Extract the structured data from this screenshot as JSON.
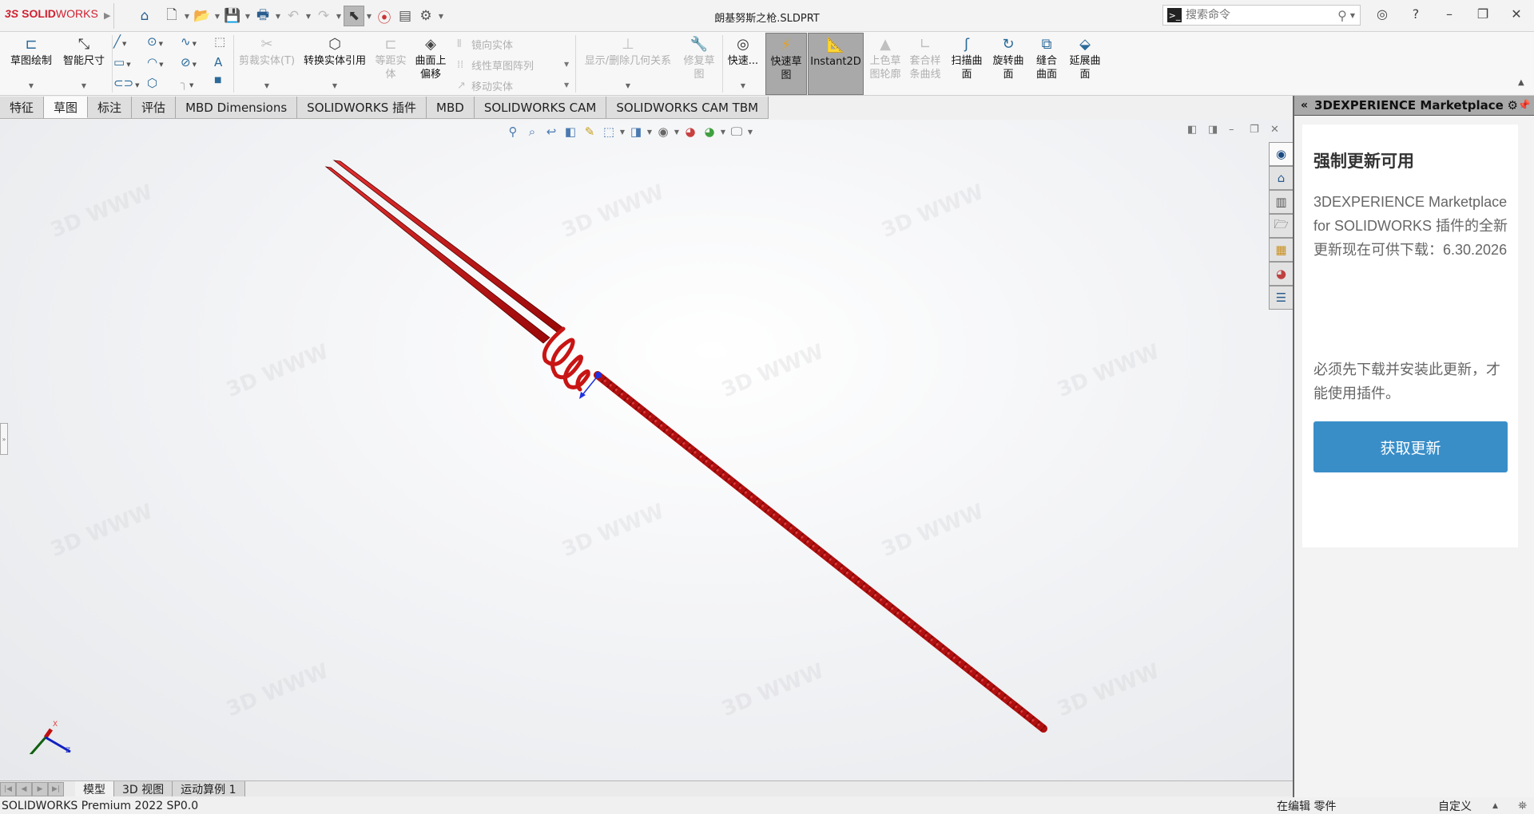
{
  "app": {
    "brand_prefix": "3S",
    "brand_bold": "SOLID",
    "brand_light": "WORKS",
    "document_title": "朗基努斯之枪.SLDPRT"
  },
  "quick_access": [
    {
      "icon": "home-icon"
    },
    {
      "icon": "new-document-icon"
    },
    {
      "icon": "open-folder-icon"
    },
    {
      "icon": "save-icon"
    },
    {
      "icon": "print-icon"
    },
    {
      "icon": "undo-icon"
    },
    {
      "icon": "redo-icon"
    },
    {
      "icon": "select-cursor-icon"
    },
    {
      "icon": "rebuild-traffic-light-icon"
    },
    {
      "icon": "file-properties-icon"
    },
    {
      "icon": "options-gear-icon"
    }
  ],
  "search": {
    "placeholder": "搜索命令"
  },
  "command_manager": {
    "sketch": "草图绘制",
    "smart_dimension": "智能尺寸",
    "trim_entities": "剪裁实体(T)",
    "convert_entities": "转换实体引用",
    "offset_entities_1": "等距实",
    "offset_entities_2": "体",
    "offset_on_surface_1": "曲面上",
    "offset_on_surface_2": "偏移",
    "mirror_entities": "镜向实体",
    "linear_pattern": "线性草图阵列",
    "move_entities": "移动实体",
    "display_relations": "显示/删除几何关系",
    "repair_sketch_1": "修复草",
    "repair_sketch_2": "图",
    "quick_snaps": "快速...",
    "rapid_sketch_1": "快速草",
    "rapid_sketch_2": "图",
    "instant2d": "Instant2D",
    "shaded_contours_1": "上色草",
    "shaded_contours_2": "图轮廓",
    "fit_spline_1": "套合样",
    "fit_spline_2": "条曲线",
    "swept_surface_1": "扫描曲",
    "swept_surface_2": "面",
    "revolved_surface_1": "旋转曲",
    "revolved_surface_2": "面",
    "knit_surface_1": "缝合",
    "knit_surface_2": "曲面",
    "extend_surface_1": "延展曲",
    "extend_surface_2": "面"
  },
  "tabs": [
    {
      "label": "特征",
      "active": false
    },
    {
      "label": "草图",
      "active": true
    },
    {
      "label": "标注",
      "active": false
    },
    {
      "label": "评估",
      "active": false
    },
    {
      "label": "MBD Dimensions",
      "active": false
    },
    {
      "label": "SOLIDWORKS 插件",
      "active": false
    },
    {
      "label": "MBD",
      "active": false
    },
    {
      "label": "SOLIDWORKS CAM",
      "active": false
    },
    {
      "label": "SOLIDWORKS CAM TBM",
      "active": false
    }
  ],
  "heads_up_toolbar": [
    "zoom-to-fit-icon",
    "zoom-to-area-icon",
    "previous-view-icon",
    "section-view-icon",
    "dynamic-annotation-icon",
    "view-orientation-icon",
    "display-style-icon",
    "hide-show-items-icon",
    "edit-appearance-icon",
    "apply-scene-icon",
    "view-settings-icon"
  ],
  "triad": {
    "x": "X",
    "y": "Y",
    "z": "Z"
  },
  "model": {
    "color": "#c81414",
    "name": "朗基努斯之枪"
  },
  "bottom_tabs": [
    {
      "label": "模型",
      "active": true
    },
    {
      "label": "3D 视图",
      "active": false
    },
    {
      "label": "运动算例 1",
      "active": false
    }
  ],
  "status": {
    "version": "SOLIDWORKS Premium 2022 SP0.0",
    "editing": "在编辑 零件",
    "units": "自定义"
  },
  "task_pane": {
    "title": "3DEXPERIENCE Marketplace",
    "heading": "强制更新可用",
    "body": "3DEXPERIENCE Marketplace for SOLIDWORKS 插件的全新更新现在可供下载：6.30.2026",
    "body2": "必须先下载并安装此更新，才能使用插件。",
    "button": "获取更新",
    "button_color": "#3a8ec8",
    "side_tabs": [
      "3dexperience-icon",
      "home-icon",
      "design-library-icon",
      "file-explorer-icon",
      "view-palette-icon",
      "appearances-icon",
      "custom-properties-icon"
    ]
  }
}
